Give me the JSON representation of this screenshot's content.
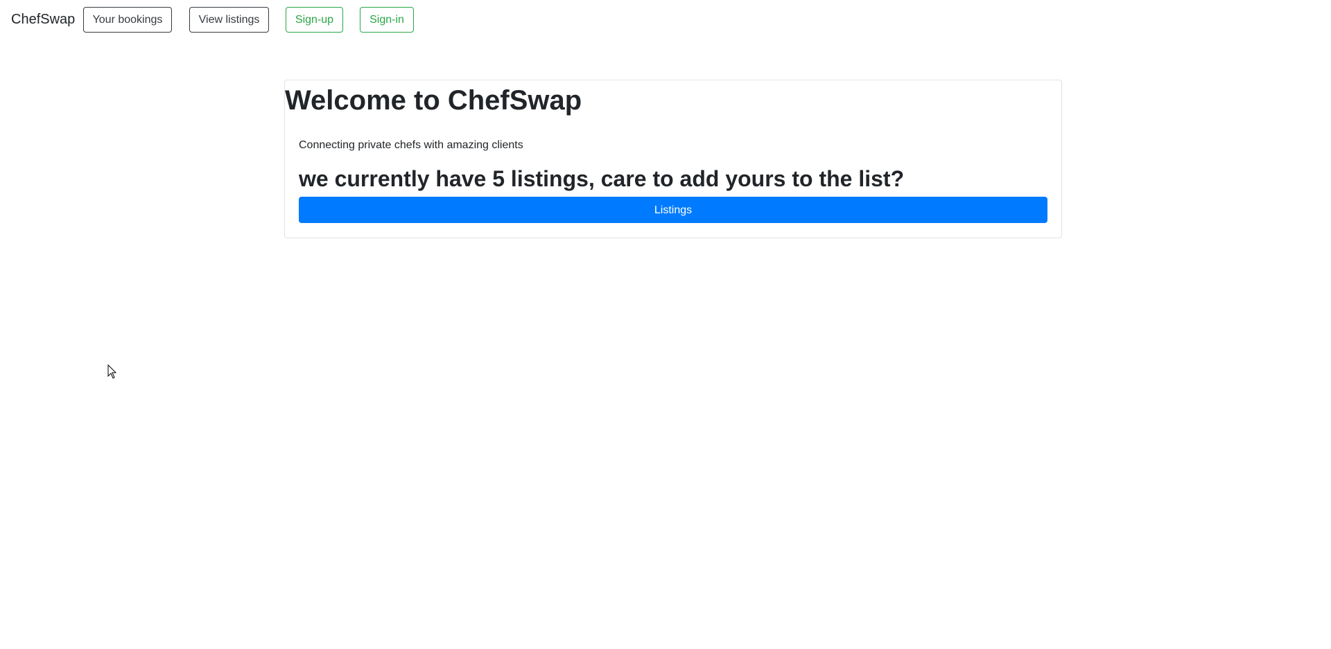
{
  "navbar": {
    "brand": "ChefSwap",
    "buttons": [
      {
        "label": "Your bookings"
      },
      {
        "label": "View listings"
      },
      {
        "label": "Sign-up"
      },
      {
        "label": "Sign-in"
      }
    ]
  },
  "welcome_card": {
    "title": "Welcome to ChefSwap",
    "subtitle": "Connecting private chefs with amazing clients",
    "listings_prompt": "we currently have 5 listings, care to add yours to the list?",
    "listings_button_label": "Listings"
  },
  "colors": {
    "primary": "#007bff",
    "success": "#28a745",
    "dark": "#343a40",
    "text": "#212529"
  },
  "icons": {
    "cursor": "mouse-pointer-icon"
  }
}
